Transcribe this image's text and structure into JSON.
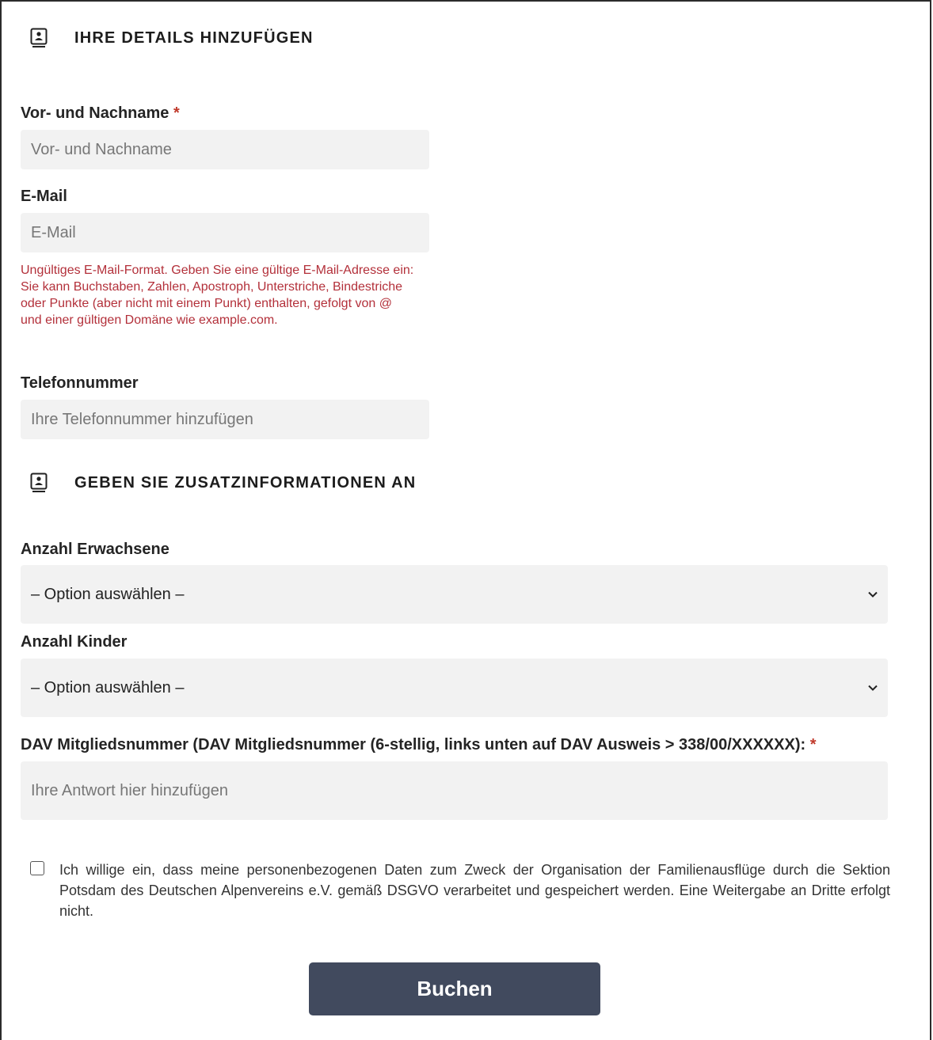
{
  "section1": {
    "title": "IHRE DETAILS HINZUFÜGEN",
    "icon": "contact-card-icon"
  },
  "name": {
    "label": "Vor- und Nachname",
    "required": "*",
    "placeholder": "Vor- und Nachname"
  },
  "email": {
    "label": "E-Mail",
    "placeholder": "E-Mail",
    "error": "Ungültiges E-Mail-Format. Geben Sie eine gültige E-Mail-Adresse ein: Sie kann Buchstaben, Zahlen, Apostroph, Unterstriche, Bindestriche oder Punkte (aber nicht mit einem Punkt) enthalten, gefolgt von @ und einer gültigen Domäne wie example.com."
  },
  "phone": {
    "label": "Telefonnummer",
    "placeholder": "Ihre Telefonnummer hinzufügen"
  },
  "section2": {
    "title": "GEBEN SIE ZUSATZINFORMATIONEN AN",
    "icon": "contact-card-icon"
  },
  "adults": {
    "label": "Anzahl Erwachsene",
    "value": "– Option auswählen –"
  },
  "children": {
    "label": "Anzahl Kinder",
    "value": "– Option auswählen –"
  },
  "dav": {
    "label": "DAV Mitgliedsnummer (DAV Mitgliedsnummer (6-stellig, links unten auf DAV Ausweis > 338/00/XXXXXX):",
    "required": "*",
    "placeholder": "Ihre Antwort hier hinzufügen"
  },
  "consent": {
    "checked": false,
    "text": "Ich willige ein, dass meine personenbezogenen Daten zum Zweck der Organisation der Familienausflüge durch die Sektion Potsdam des Deutschen Alpenvereins e.V. gemäß DSGVO verarbeitet und gespeichert werden. Eine Weitergabe an Dritte erfolgt nicht."
  },
  "submit": {
    "label": "Buchen"
  },
  "colors": {
    "error": "#b3303a",
    "required": "#c0392b",
    "button": "#414a5e",
    "field": "#f2f2f2"
  }
}
